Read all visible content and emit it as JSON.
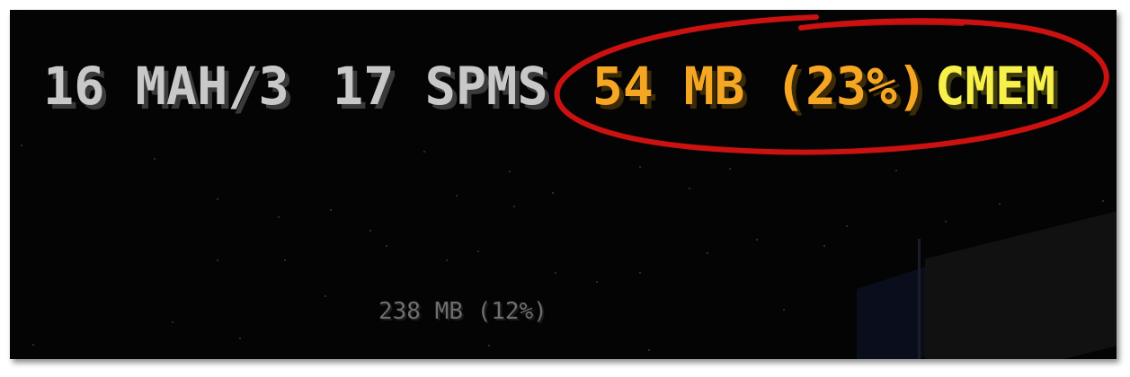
{
  "hud": {
    "fps": "16 MAH/3",
    "ping": "17 SPMS",
    "memory": "54 MB (23%)",
    "cmem": "CMEM",
    "secondary_memory": "238 MB (12%)"
  },
  "colors": {
    "background": "#040404",
    "hud_gray": "#c8c8c8",
    "memory_orange": "#f5a623",
    "cmem_yellow": "#f7f04a",
    "secondary_gray": "#6e6e6e",
    "annotation_red": "#cc1111"
  },
  "annotation": {
    "shape": "ellipse",
    "color": "#cc1111",
    "encircles": "memory and cmem readout"
  }
}
